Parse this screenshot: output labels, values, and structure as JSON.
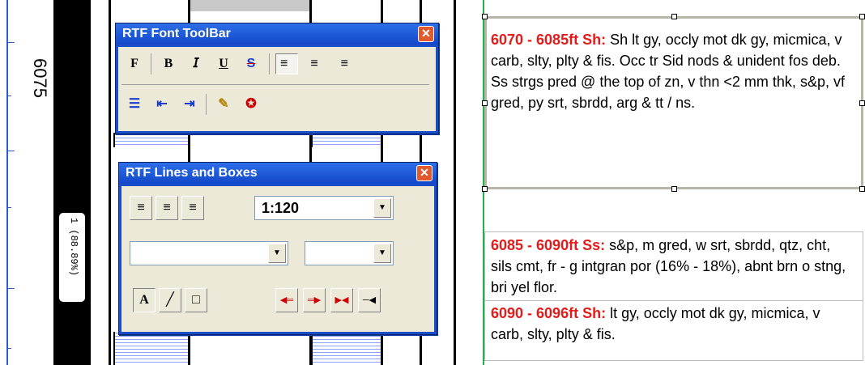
{
  "depth_marker": "6075",
  "rotated_tag": "1 (88.89%)",
  "font_toolbar": {
    "title": "RTF Font ToolBar",
    "close": "✕",
    "buttons": [
      "F",
      "B",
      "𝘐",
      "U",
      "S",
      "≡",
      "≡",
      "≡"
    ],
    "row2": [
      "☰",
      "⇤",
      "⇥",
      "✎",
      "✪"
    ]
  },
  "lines_toolbar": {
    "title": "RTF Lines and Boxes",
    "close": "✕",
    "scale_value": "1:120",
    "dropdown_arrow": "▼",
    "draw_buttons": [
      "A",
      "╱",
      "□"
    ]
  },
  "descriptions": [
    {
      "range": "6070 - 6085ft Sh:",
      "text": " Sh lt gy, occly mot dk gy, micmica, v carb, slty, plty & fis. Occ tr Sid nods & unident fos deb. Ss strgs pred @ the top of zn, v thn <2 mm thk, s&p, vf gred, py srt, sbrdd, arg & tt / ns."
    },
    {
      "range": "6085 - 6090ft Ss:",
      "text": " s&p, m gred, w srt, sbrdd, qtz, cht, sils cmt, fr - g intgran por (16% - 18%), abnt brn o stng, bri yel flor."
    },
    {
      "range": "6090 - 6096ft Sh:",
      "text": " lt gy, occly mot dk gy, micmica, v carb, slty, plty & fis."
    }
  ]
}
